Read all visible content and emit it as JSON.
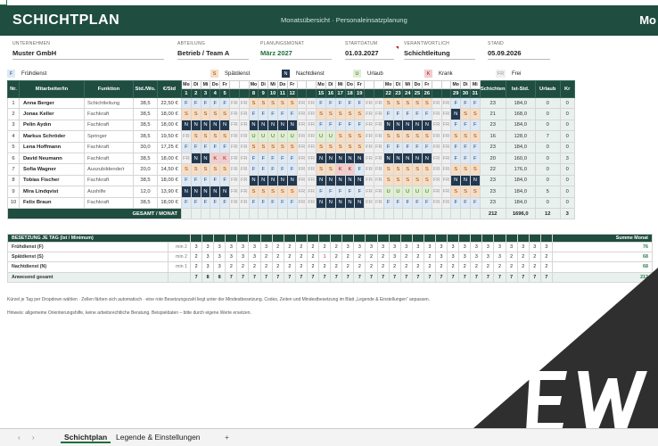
{
  "header": {
    "title": "SCHICHTPLAN",
    "subtitle": "Monatsübersicht · Personaleinsatzplanung",
    "corner": "Mo"
  },
  "meta": [
    {
      "label": "UNTERNEHMEN",
      "value": "Muster GmbH"
    },
    {
      "label": "ABTEILUNG",
      "value": "Betrieb / Team A"
    },
    {
      "label": "PLANUNGSMONAT",
      "value": "März 2027"
    },
    {
      "label": "STARTDATUM",
      "value": "01.03.2027"
    },
    {
      "label": "VERANTWORTLICH",
      "value": "Schichtleitung"
    },
    {
      "label": "STAND",
      "value": "05.09.2026"
    }
  ],
  "legend": [
    {
      "code": "F",
      "label": "Frühdienst"
    },
    {
      "code": "S",
      "label": "Spätdienst"
    },
    {
      "code": "N",
      "label": "Nachtdienst"
    },
    {
      "code": "U",
      "label": "Urlaub"
    },
    {
      "code": "K",
      "label": "Krank"
    },
    {
      "code": "FR",
      "label": "Frei"
    }
  ],
  "table": {
    "headers": {
      "nr": "Nr.",
      "name": "Mitarbeiter/in",
      "func": "Funktion",
      "hours": "Std./Wo.",
      "rate": "€/Std",
      "shifts": "Schichten",
      "ist": "Ist-Std.",
      "urlaub": "Urlaub",
      "more": "Kr"
    },
    "day_names": [
      "Mo",
      "Di",
      "Mi",
      "Do",
      "Fr",
      "",
      "",
      "Mo",
      "Di",
      "Mi",
      "Do",
      "Fr",
      "",
      "",
      "Mo",
      "Di",
      "Mi",
      "Do",
      "Fr",
      "",
      "",
      "Mo",
      "Di",
      "Mi",
      "Do",
      "Fr",
      "",
      "",
      "Mo",
      "Di",
      "Mi"
    ],
    "day_numbers": [
      "1",
      "2",
      "3",
      "4",
      "5",
      "",
      "",
      "8",
      "9",
      "10",
      "11",
      "12",
      "",
      "",
      "15",
      "16",
      "17",
      "18",
      "19",
      "",
      "",
      "22",
      "23",
      "24",
      "25",
      "26",
      "",
      "",
      "29",
      "30",
      "31"
    ],
    "rows": [
      {
        "nr": "1",
        "name": "Anna Berger",
        "func": "Schichtleitung",
        "hours": "38,5",
        "rate": "22,50 €",
        "shifts": "23",
        "ist": "184,0",
        "urlaub": "0",
        "more": "0",
        "days": [
          "F",
          "F",
          "F",
          "F",
          "F",
          "FR",
          "FR",
          "S",
          "S",
          "S",
          "S",
          "S",
          "FR",
          "FR",
          "F",
          "F",
          "F",
          "F",
          "F",
          "FR",
          "FR",
          "S",
          "S",
          "S",
          "S",
          "S",
          "FR",
          "FR",
          "F",
          "F",
          "F"
        ]
      },
      {
        "nr": "2",
        "name": "Jonas Keller",
        "func": "Fachkraft",
        "hours": "38,5",
        "rate": "18,00 €",
        "shifts": "21",
        "ist": "168,0",
        "urlaub": "0",
        "more": "0",
        "days": [
          "S",
          "S",
          "S",
          "S",
          "S",
          "FR",
          "FR",
          "F",
          "F",
          "F",
          "F",
          "F",
          "FR",
          "FR",
          "S",
          "S",
          "S",
          "S",
          "S",
          "FR",
          "FR",
          "F",
          "F",
          "F",
          "F",
          "F",
          "FR",
          "FR",
          "N",
          "S",
          "S"
        ]
      },
      {
        "nr": "3",
        "name": "Pelin Aydın",
        "func": "Fachkraft",
        "hours": "38,5",
        "rate": "18,00 €",
        "shifts": "23",
        "ist": "184,0",
        "urlaub": "0",
        "more": "0",
        "days": [
          "N",
          "N",
          "N",
          "N",
          "N",
          "FR",
          "FR",
          "N",
          "N",
          "N",
          "N",
          "N",
          "FR",
          "FR",
          "F",
          "F",
          "F",
          "F",
          "F",
          "FR",
          "FR",
          "N",
          "N",
          "N",
          "N",
          "N",
          "FR",
          "FR",
          "F",
          "F",
          "F"
        ]
      },
      {
        "nr": "4",
        "name": "Markus Schröder",
        "func": "Springer",
        "hours": "38,5",
        "rate": "19,50 €",
        "shifts": "16",
        "ist": "128,0",
        "urlaub": "7",
        "more": "0",
        "days": [
          "FR",
          "S",
          "S",
          "S",
          "S",
          "FR",
          "FR",
          "U",
          "U",
          "U",
          "U",
          "U",
          "FR",
          "FR",
          "U",
          "U",
          "S",
          "S",
          "S",
          "FR",
          "FR",
          "S",
          "S",
          "S",
          "S",
          "S",
          "FR",
          "FR",
          "S",
          "S",
          "S"
        ]
      },
      {
        "nr": "5",
        "name": "Lena Hoffmann",
        "func": "Fachkraft",
        "hours": "30,0",
        "rate": "17,25 €",
        "shifts": "23",
        "ist": "184,0",
        "urlaub": "0",
        "more": "0",
        "days": [
          "F",
          "F",
          "F",
          "F",
          "F",
          "FR",
          "FR",
          "S",
          "S",
          "S",
          "S",
          "S",
          "FR",
          "FR",
          "S",
          "S",
          "S",
          "S",
          "S",
          "FR",
          "FR",
          "F",
          "F",
          "F",
          "F",
          "F",
          "FR",
          "FR",
          "F",
          "F",
          "F"
        ]
      },
      {
        "nr": "6",
        "name": "David Neumann",
        "func": "Fachkraft",
        "hours": "38,5",
        "rate": "18,00 €",
        "shifts": "20",
        "ist": "160,0",
        "urlaub": "0",
        "more": "3",
        "days": [
          "FR",
          "N",
          "N",
          "K",
          "K",
          "FR",
          "FR",
          "F",
          "F",
          "F",
          "F",
          "F",
          "FR",
          "FR",
          "N",
          "N",
          "N",
          "N",
          "N",
          "FR",
          "FR",
          "N",
          "N",
          "N",
          "N",
          "N",
          "FR",
          "FR",
          "F",
          "F",
          "F"
        ]
      },
      {
        "nr": "7",
        "name": "Sofia Wagner",
        "func": "Auszubildende/r",
        "hours": "20,0",
        "rate": "14,50 €",
        "shifts": "22",
        "ist": "176,0",
        "urlaub": "0",
        "more": "0",
        "days": [
          "S",
          "S",
          "S",
          "S",
          "S",
          "FR",
          "FR",
          "F",
          "F",
          "F",
          "F",
          "F",
          "FR",
          "FR",
          "S",
          "S",
          "K",
          "K",
          "F",
          "FR",
          "FR",
          "S",
          "S",
          "S",
          "S",
          "S",
          "FR",
          "FR",
          "S",
          "S",
          "S"
        ]
      },
      {
        "nr": "8",
        "name": "Tobias Fischer",
        "func": "Fachkraft",
        "hours": "38,5",
        "rate": "18,00 €",
        "shifts": "23",
        "ist": "184,0",
        "urlaub": "0",
        "more": "0",
        "days": [
          "F",
          "F",
          "F",
          "F",
          "F",
          "FR",
          "FR",
          "N",
          "N",
          "N",
          "N",
          "N",
          "FR",
          "FR",
          "N",
          "N",
          "N",
          "N",
          "N",
          "FR",
          "FR",
          "S",
          "S",
          "S",
          "S",
          "S",
          "FR",
          "FR",
          "N",
          "N",
          "N"
        ]
      },
      {
        "nr": "9",
        "name": "Mira Lindqvist",
        "func": "Aushilfe",
        "hours": "12,0",
        "rate": "13,90 €",
        "shifts": "23",
        "ist": "184,0",
        "urlaub": "5",
        "more": "0",
        "days": [
          "N",
          "N",
          "N",
          "N",
          "N",
          "FR",
          "FR",
          "S",
          "S",
          "S",
          "S",
          "S",
          "FR",
          "FR",
          "F",
          "F",
          "F",
          "F",
          "F",
          "FR",
          "FR",
          "U",
          "U",
          "U",
          "U",
          "U",
          "FR",
          "FR",
          "S",
          "S",
          "S"
        ]
      },
      {
        "nr": "10",
        "name": "Felix Braun",
        "func": "Fachkraft",
        "hours": "38,5",
        "rate": "18,00 €",
        "shifts": "23",
        "ist": "184,0",
        "urlaub": "0",
        "more": "0",
        "days": [
          "F",
          "F",
          "F",
          "F",
          "F",
          "FR",
          "FR",
          "F",
          "F",
          "F",
          "F",
          "F",
          "FR",
          "FR",
          "N",
          "N",
          "N",
          "N",
          "N",
          "FR",
          "FR",
          "F",
          "F",
          "F",
          "F",
          "F",
          "FR",
          "FR",
          "F",
          "F",
          "F"
        ]
      }
    ],
    "total": {
      "label": "GESAMT / MONAT",
      "shifts": "212",
      "ist": "1696,0",
      "urlaub": "12",
      "more": "3"
    }
  },
  "occupancy": {
    "title": "BESETZUNG JE TAG (Ist / Minimum)",
    "sum_title": "Summe Monat",
    "rows": [
      {
        "label": "Frühdienst (F)",
        "min": "min 2",
        "values": [
          "3",
          "3",
          "3",
          "3",
          "3",
          "3",
          "3",
          "2",
          "2",
          "2",
          "2",
          "2",
          "2",
          "3",
          "3",
          "3",
          "3",
          "3",
          "3",
          "3",
          "3",
          "3",
          "3",
          "3",
          "3",
          "3",
          "3",
          "3",
          "3",
          "3",
          "3"
        ],
        "sum": "76"
      },
      {
        "label": "Spätdienst (S)",
        "min": "min 2",
        "values": [
          "2",
          "3",
          "3",
          "3",
          "3",
          "3",
          "2",
          "2",
          "2",
          "2",
          "2",
          "1",
          "2",
          "2",
          "2",
          "2",
          "2",
          "3",
          "2",
          "2",
          "2",
          "3",
          "3",
          "3",
          "3",
          "3",
          "3",
          "2",
          "2",
          "2",
          "2"
        ],
        "sum": "68"
      },
      {
        "label": "Nachtdienst (N)",
        "min": "min 1",
        "values": [
          "2",
          "3",
          "3",
          "2",
          "2",
          "2",
          "2",
          "2",
          "2",
          "2",
          "2",
          "2",
          "2",
          "2",
          "2",
          "2",
          "2",
          "2",
          "2",
          "2",
          "2",
          "2",
          "2",
          "2",
          "2",
          "2",
          "2",
          "2",
          "2",
          "2",
          "2"
        ],
        "sum": "68"
      },
      {
        "label": "Anwesend gesamt",
        "min": "",
        "values": [
          "7",
          "8",
          "8",
          "7",
          "7",
          "7",
          "7",
          "7",
          "7",
          "7",
          "7",
          "7",
          "7",
          "7",
          "7",
          "7",
          "7",
          "7",
          "7",
          "7",
          "7",
          "7",
          "7",
          "7",
          "7",
          "7",
          "7",
          "7",
          "7",
          "7",
          "7"
        ],
        "sum": "212"
      }
    ]
  },
  "notes": [
    "Kürzel je Tag per Dropdown wählen · Zellen färben sich automatisch · eine rote Besetzungszahl liegt unter der Mindestbesetzung. Codes, Zeiten und Mindestbesetzung im Blatt „Legende & Einstellungen“ anpassen.",
    "Hinweis: allgemeine Orientierungshilfe, keine arbeitsrechtliche Beratung. Beispieldaten – bitte durch eigene Werte ersetzen."
  ],
  "tabs": {
    "active": "Schichtplan",
    "other": "Legende & Einstellungen",
    "add": "+",
    "prev": "‹",
    "next": "›"
  },
  "colors": {
    "header": "#1f4d40",
    "F": "#dde9f5",
    "S": "#f7ddc3",
    "N": "#22384f",
    "U": "#e0efd2",
    "K": "#f4cccc",
    "FR": "#f0f0f0"
  }
}
